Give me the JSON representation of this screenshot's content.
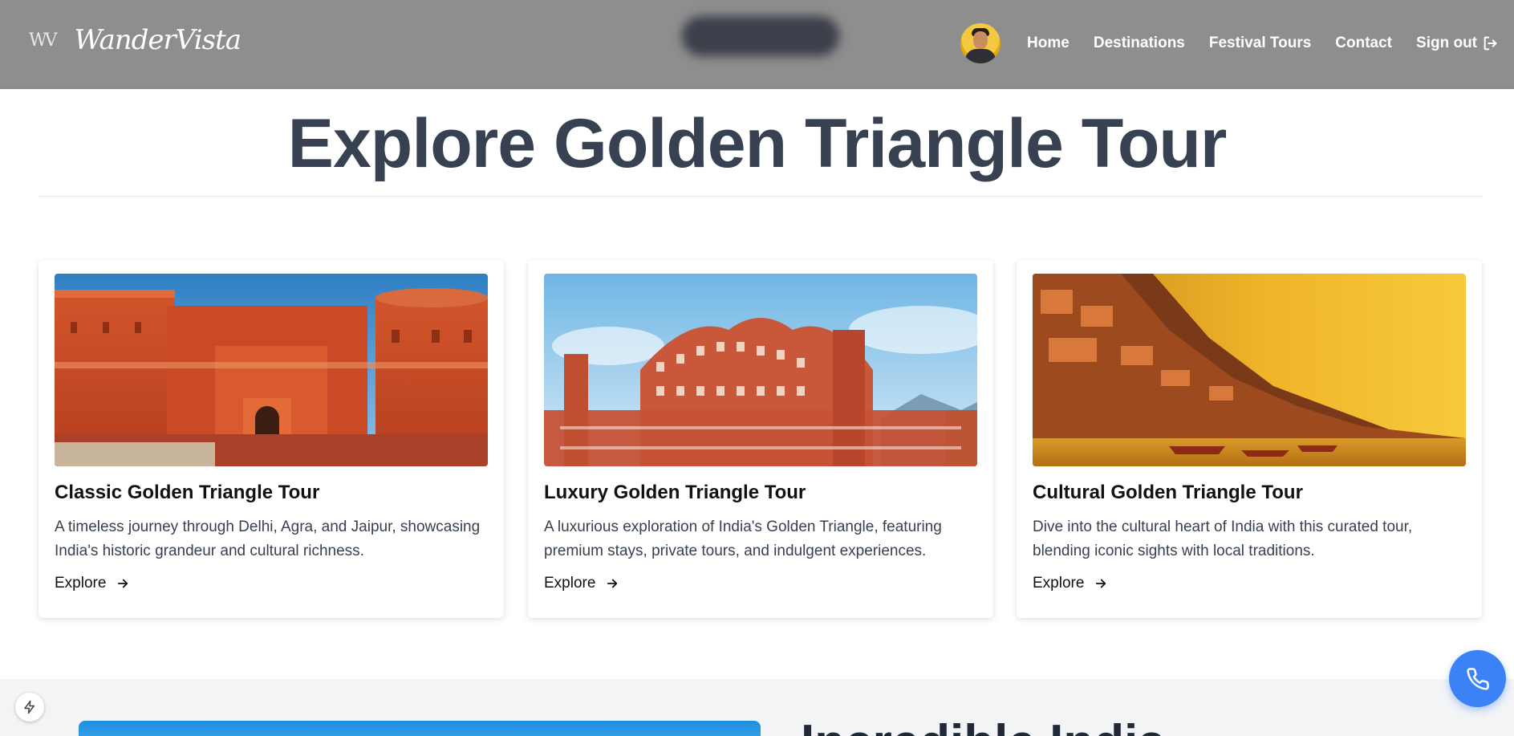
{
  "brand": {
    "mark": "WV",
    "name": "WanderVista"
  },
  "nav": {
    "links": [
      "Home",
      "Destinations",
      "Festival Tours",
      "Contact"
    ],
    "signout_label": "Sign out"
  },
  "page": {
    "title": "Explore Golden Triangle Tour"
  },
  "cards": [
    {
      "title": "Classic Golden Triangle Tour",
      "description": "A timeless journey through Delhi, Agra, and Jaipur, showcasing India's historic grandeur and cultural richness.",
      "link_label": "Explore",
      "image": "red-fort-agra"
    },
    {
      "title": "Luxury Golden Triangle Tour",
      "description": "A luxurious exploration of India's Golden Triangle, featuring premium stays, private tours, and indulgent experiences.",
      "link_label": "Explore",
      "image": "hawa-mahal-jaipur"
    },
    {
      "title": "Cultural Golden Triangle Tour",
      "description": "Dive into the cultural heart of India with this curated tour, blending iconic sights with local traditions.",
      "link_label": "Explore",
      "image": "varanasi-ghats-sunset"
    }
  ],
  "lower_section": {
    "title": "Incredible India"
  },
  "colors": {
    "navbar_bg": "#8e8e8e",
    "title_text": "#374151",
    "accent_blue": "#3b82f6",
    "section_bg": "#f3f4f6"
  },
  "icons": {
    "signout": "sign-out-icon",
    "arrow": "arrow-right-icon",
    "call": "phone-icon",
    "bolt": "bolt-icon"
  }
}
